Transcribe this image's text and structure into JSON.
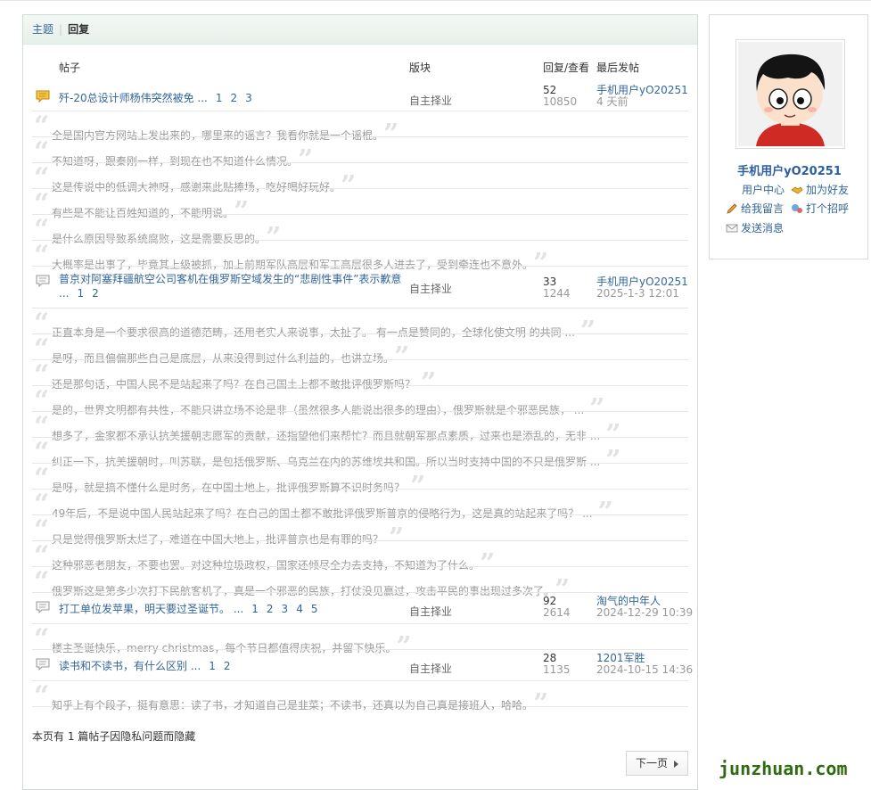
{
  "tabs": {
    "topic": "主题",
    "reply": "回复"
  },
  "columns": {
    "post": "帖子",
    "forum": "版块",
    "stats": "回复/查看",
    "last": "最后发帖"
  },
  "threads": [
    {
      "title": "歼-20总设计师杨伟突然被免 ...",
      "pages": [
        "1",
        "2",
        "3"
      ],
      "forum": "自主择业",
      "replies": "52",
      "views": "10850",
      "last_user": "手机用户yO20251",
      "last_time": "4 天前",
      "quotes": [
        "全是国内官方网站上发出来的，哪里来的谣言？我看你就是一个谣棍。",
        "不知道呀，跟秦刚一样，到现在也不知道什么情况。",
        "这是传说中的低调大神呀，感谢来此贴捧场，吃好喝好玩好。",
        "有些是不能让百姓知道的，不能明说。",
        "是什么原因导致系统腐败，这是需要反思的。",
        "大概率是出事了，毕竟其上级被抓，加上前期军队高层和军工高层很多人进去了，受到牵连也不意外。"
      ]
    },
    {
      "title": "普京对阿塞拜疆航空公司客机在俄罗斯空域发生的“悲剧性事件”表示歉意 ...",
      "pages": [
        "1",
        "2"
      ],
      "forum": "自主择业",
      "replies": "33",
      "views": "1244",
      "last_user": "手机用户yO20251",
      "last_time": "2025-1-3 12:01",
      "quotes": [
        "正直本身是一个要求很高的道德范畴，还用老实人来说事，太扯了。 有一点是赞同的，全球化使文明 的共同 ...",
        "是呀，而且偏偏那些自己是底层，从来没得到过什么利益的，也讲立场。",
        "还是那句话，中国人民不是站起来了吗？在自己国土上都不敢批评俄罗斯吗？",
        "是的，世界文明都有共性，不能只讲立场不论是非（虽然很多人能说出很多的理由），俄罗斯就是个邪恶民族，  ...",
        "想多了，金家都不承认抗美援朝志愿军的贡献，还指望他们来帮忙？而且就朝军那点素质，过来也是添乱的，无非 ...",
        "纠正一下，抗美援朝时，叫苏联，是包括俄罗斯、乌克兰在内的苏维埃共和国。所以当时支持中国的不只是俄罗斯 ...",
        "是呀，就是搞不懂什么是时务，在中国土地上，批评俄罗斯算不识时务吗？",
        "49年后，不是说中国人民站起来了吗？在自己的国土都不敢批评俄罗斯普京的侵略行为，这是真的站起来了吗？  ...",
        "只是觉得俄罗斯太烂了，难道在中国大地上，批评普京也是有罪的吗？",
        "这种邪恶老朋友，不要也罢。对这种垃圾政权，国家还倾尽全力去支持，不知道为了什么。",
        "俄罗斯这是第多少次打下民航客机了，真是一个邪恶的民族，打仗没见赢过，攻击平民的事出现过多次了。"
      ]
    },
    {
      "title": "打工单位发苹果，明天要过圣诞节。 ...",
      "pages": [
        "1",
        "2",
        "3",
        "4",
        "5"
      ],
      "forum": "自主择业",
      "replies": "92",
      "views": "2614",
      "last_user": "淘气的中年人",
      "last_time": "2024-12-29 10:39",
      "quotes": [
        "楼主圣诞快乐，merry christmas，每个节日都值得庆祝，并留下快乐。"
      ]
    },
    {
      "title": "读书和不读书，有什么区别 ...",
      "pages": [
        "1",
        "2"
      ],
      "forum": "自主择业",
      "replies": "28",
      "views": "1135",
      "last_user": "1201军胜",
      "last_time": "2024-10-15 14:36",
      "quotes": [
        "知乎上有个段子，挺有意思：读了书，才知道自己是韭菜；不读书，还真以为自己真是接班人，哈哈。"
      ]
    }
  ],
  "hidden_note": "本页有 1 篇帖子因隐私问题而隐藏",
  "next_label": "下一页",
  "profile": {
    "username": "手机用户yO20251",
    "links": {
      "center": "用户中心",
      "add_friend": "加为好友",
      "message": "给我留言",
      "greet": "打个招呼",
      "send": "发送消息"
    }
  },
  "watermark": "junzhuan.com",
  "colors": {
    "link": "#336699",
    "muted": "#999999",
    "tab_bg": "#e7f0ea"
  }
}
